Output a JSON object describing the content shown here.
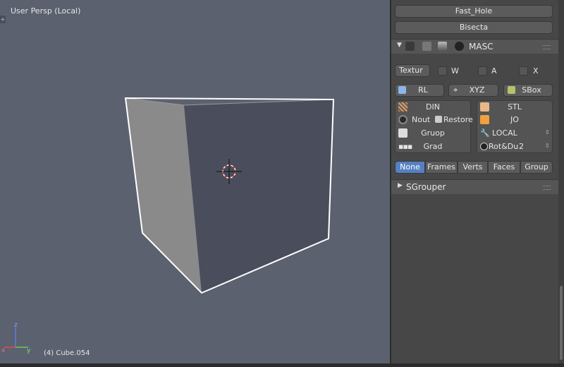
{
  "viewport": {
    "label": "User Persp (Local)",
    "object": "(4) Cube.054",
    "axis": {
      "x": "x",
      "y": "y",
      "z": "z"
    }
  },
  "panel": {
    "top_buttons": [
      "Fast_Hole",
      "Bisecta"
    ],
    "masc": {
      "title": "MASC",
      "texture_select": "Textur",
      "checks": [
        "W",
        "A",
        "X"
      ],
      "row_rl": "RL",
      "row_xyz": "XYZ",
      "row_sbox": "SBox",
      "left_col": [
        "DIN",
        "Nout",
        "Restore",
        "Gruop",
        "Grad"
      ],
      "right_col": [
        "STL",
        "JO",
        "LOCAL",
        "Rot&Du",
        "2"
      ],
      "tabs": [
        "None",
        "Frames",
        "Verts",
        "Faces",
        "Group"
      ],
      "active_tab": "None"
    },
    "sgrouper": {
      "title": "SGrouper"
    }
  },
  "colors": {
    "viewport_bg": "#5c6170",
    "panel_bg": "#474747",
    "active_tab": "#5680c2"
  }
}
